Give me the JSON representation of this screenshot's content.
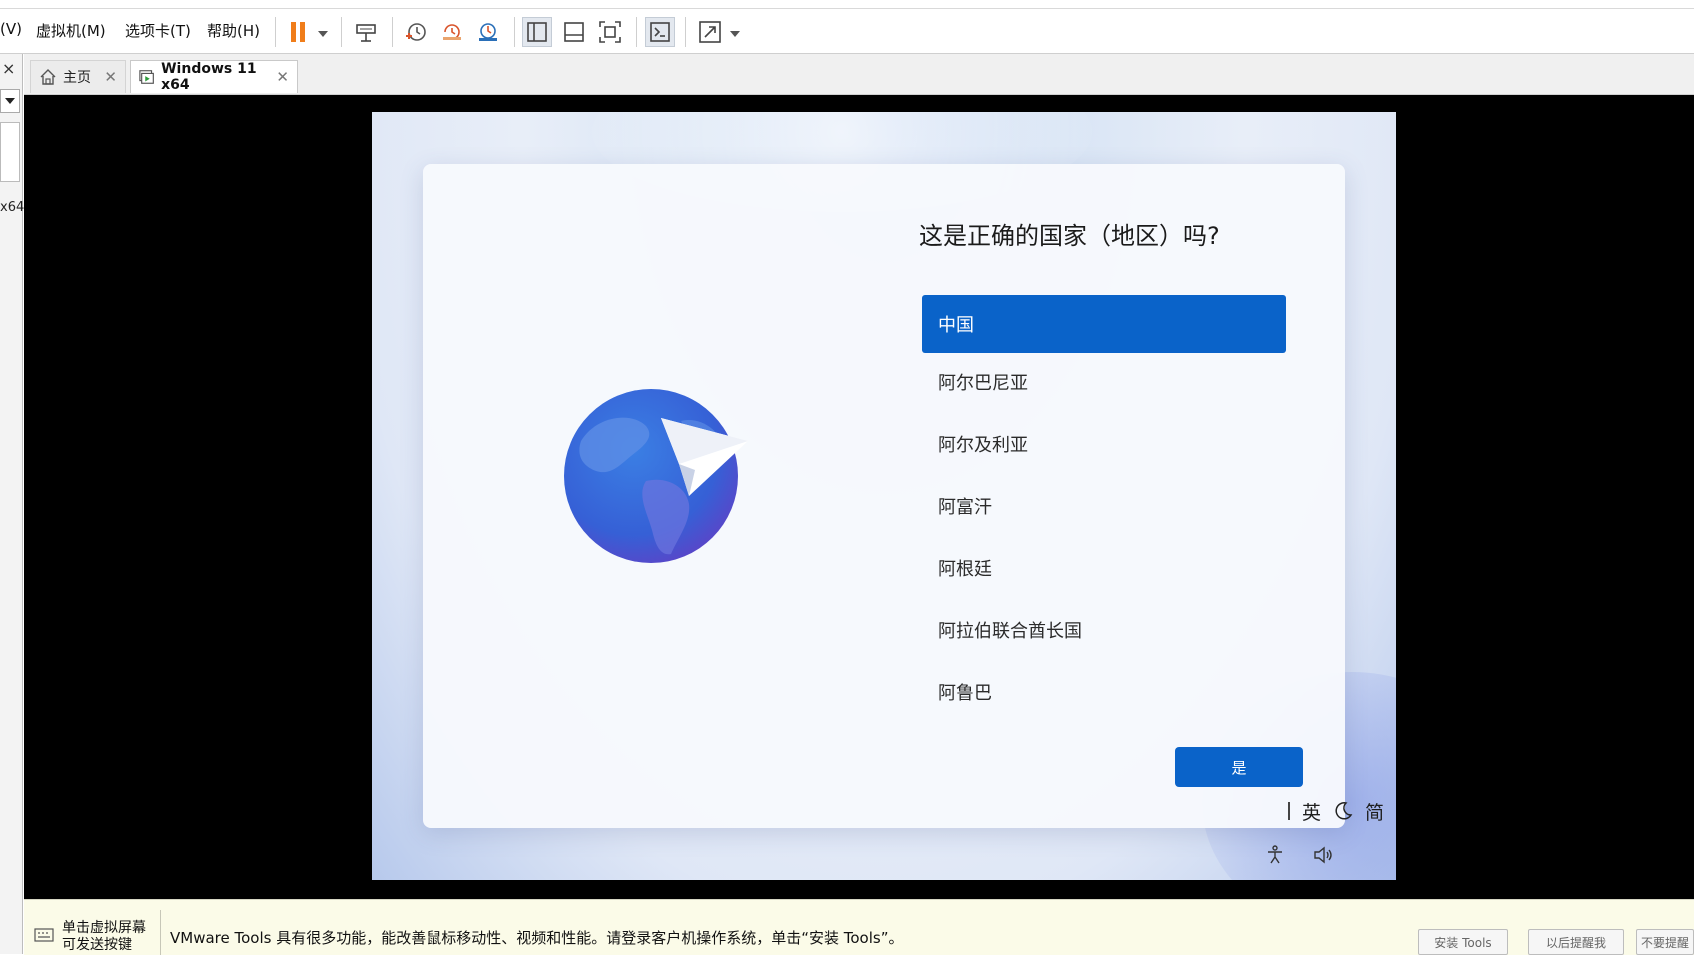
{
  "menubar": {
    "items": [
      {
        "label": "(V)"
      },
      {
        "label": "虚拟机(M)"
      },
      {
        "label": "选项卡(T)"
      },
      {
        "label": "帮助(H)"
      }
    ],
    "colors": {
      "pause_accent": "#f07d1a",
      "snapshot_accent": "#d9542b"
    }
  },
  "leftstrip": {
    "close_glyph": "×",
    "fragment": "x64"
  },
  "tabs": [
    {
      "label": "主页",
      "icon": "home-icon",
      "active": false
    },
    {
      "label": "Windows 11 x64",
      "icon": "vm-running-icon",
      "active": true
    }
  ],
  "oobe": {
    "title": "这是正确的国家（地区）吗?",
    "countries": [
      {
        "label": "中国",
        "selected": true
      },
      {
        "label": "阿尔巴尼亚",
        "selected": false
      },
      {
        "label": "阿尔及利亚",
        "selected": false
      },
      {
        "label": "阿富汗",
        "selected": false
      },
      {
        "label": "阿根廷",
        "selected": false
      },
      {
        "label": "阿拉伯联合酋长国",
        "selected": false
      },
      {
        "label": "阿鲁巴",
        "selected": false
      }
    ],
    "yes_label": "是",
    "ime": {
      "lang": "英",
      "mode": "简"
    },
    "accent": "#0a63c9",
    "illustration": "globe-with-paper-plane-icon"
  },
  "statusbar": {
    "hint_line1": "单击虚拟屏幕",
    "hint_line2": "可发送按键",
    "message": "VMware Tools 具有很多功能，能改善鼠标移动性、视频和性能。请登录客户机操作系统，单击“安装 Tools”。",
    "buttons": [
      {
        "label": "安装 Tools"
      },
      {
        "label": "以后提醒我"
      },
      {
        "label": "不要提醒"
      }
    ]
  }
}
